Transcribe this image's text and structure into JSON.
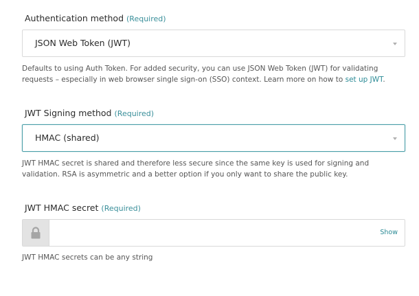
{
  "auth_method": {
    "label": "Authentication method",
    "required": "(Required)",
    "selected": "JSON Web Token (JWT)",
    "help_text": "Defaults to using Auth Token. For added security, you can use JSON Web Token (JWT) for validating requests – especially in web browser single sign-on (SSO) context. Learn more on how to ",
    "help_link": "set up JWT",
    "help_end": "."
  },
  "signing_method": {
    "label": "JWT Signing method",
    "required": "(Required)",
    "selected": "HMAC (shared)",
    "help_text": "JWT HMAC secret is shared and therefore less secure since the same key is used for signing and validation. RSA is asymmetric and a better option if you only want to share the public key."
  },
  "hmac_secret": {
    "label": "JWT HMAC secret",
    "required": "(Required)",
    "value": "",
    "show_label": "Show",
    "help_text": "JWT HMAC secrets can be any string"
  },
  "colors": {
    "accent": "#2a8a95",
    "focus_border": "#4a9ea8",
    "text": "#2b2b2b",
    "muted": "#555555"
  }
}
